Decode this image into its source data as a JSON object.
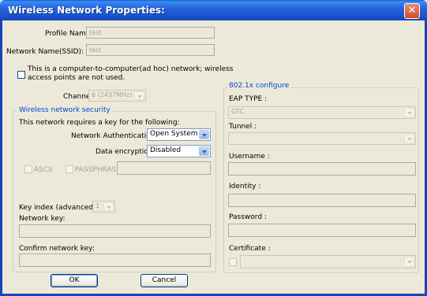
{
  "window": {
    "title": "Wireless Network Properties:",
    "close_glyph": "✕"
  },
  "profile": {
    "label": "Profile Name:",
    "value": "test"
  },
  "ssid": {
    "label": "Network Name(SSID):",
    "value": "test"
  },
  "adhoc": {
    "text_line1": "This is a computer-to-computer(ad hoc) network; wireless",
    "text_line2": "access points are not used."
  },
  "channel": {
    "label": "Channel:",
    "value": "6  (2437MHz)"
  },
  "security": {
    "group_label": "Wireless network security",
    "requires_text": "This network requires a key for the following:",
    "auth_label": "Network Authentication:",
    "auth_value": "Open System",
    "enc_label": "Data encryption:",
    "enc_value": "Disabled",
    "ascii_label": "ASCII",
    "passphrase_label": "PASSPHRASE",
    "key_index_label": "Key index (advanced):",
    "key_index_value": "1",
    "network_key_label": "Network key:",
    "confirm_key_label": "Confirm network key:"
  },
  "dot1x": {
    "group_label": "802.1x configure",
    "eap_label": "EAP TYPE :",
    "eap_value": "GTC",
    "tunnel_label": "Tunnel :",
    "username_label": "Username :",
    "identity_label": "Identity :",
    "password_label": "Password :",
    "certificate_label": "Certificate :"
  },
  "buttons": {
    "ok_label": "OK",
    "cancel_label": "Cancel"
  },
  "colors": {
    "titlebar": "#1B55D0",
    "dialog_bg": "#ECE9D8",
    "group_label": "#0046D5",
    "close": "#D34B27"
  }
}
